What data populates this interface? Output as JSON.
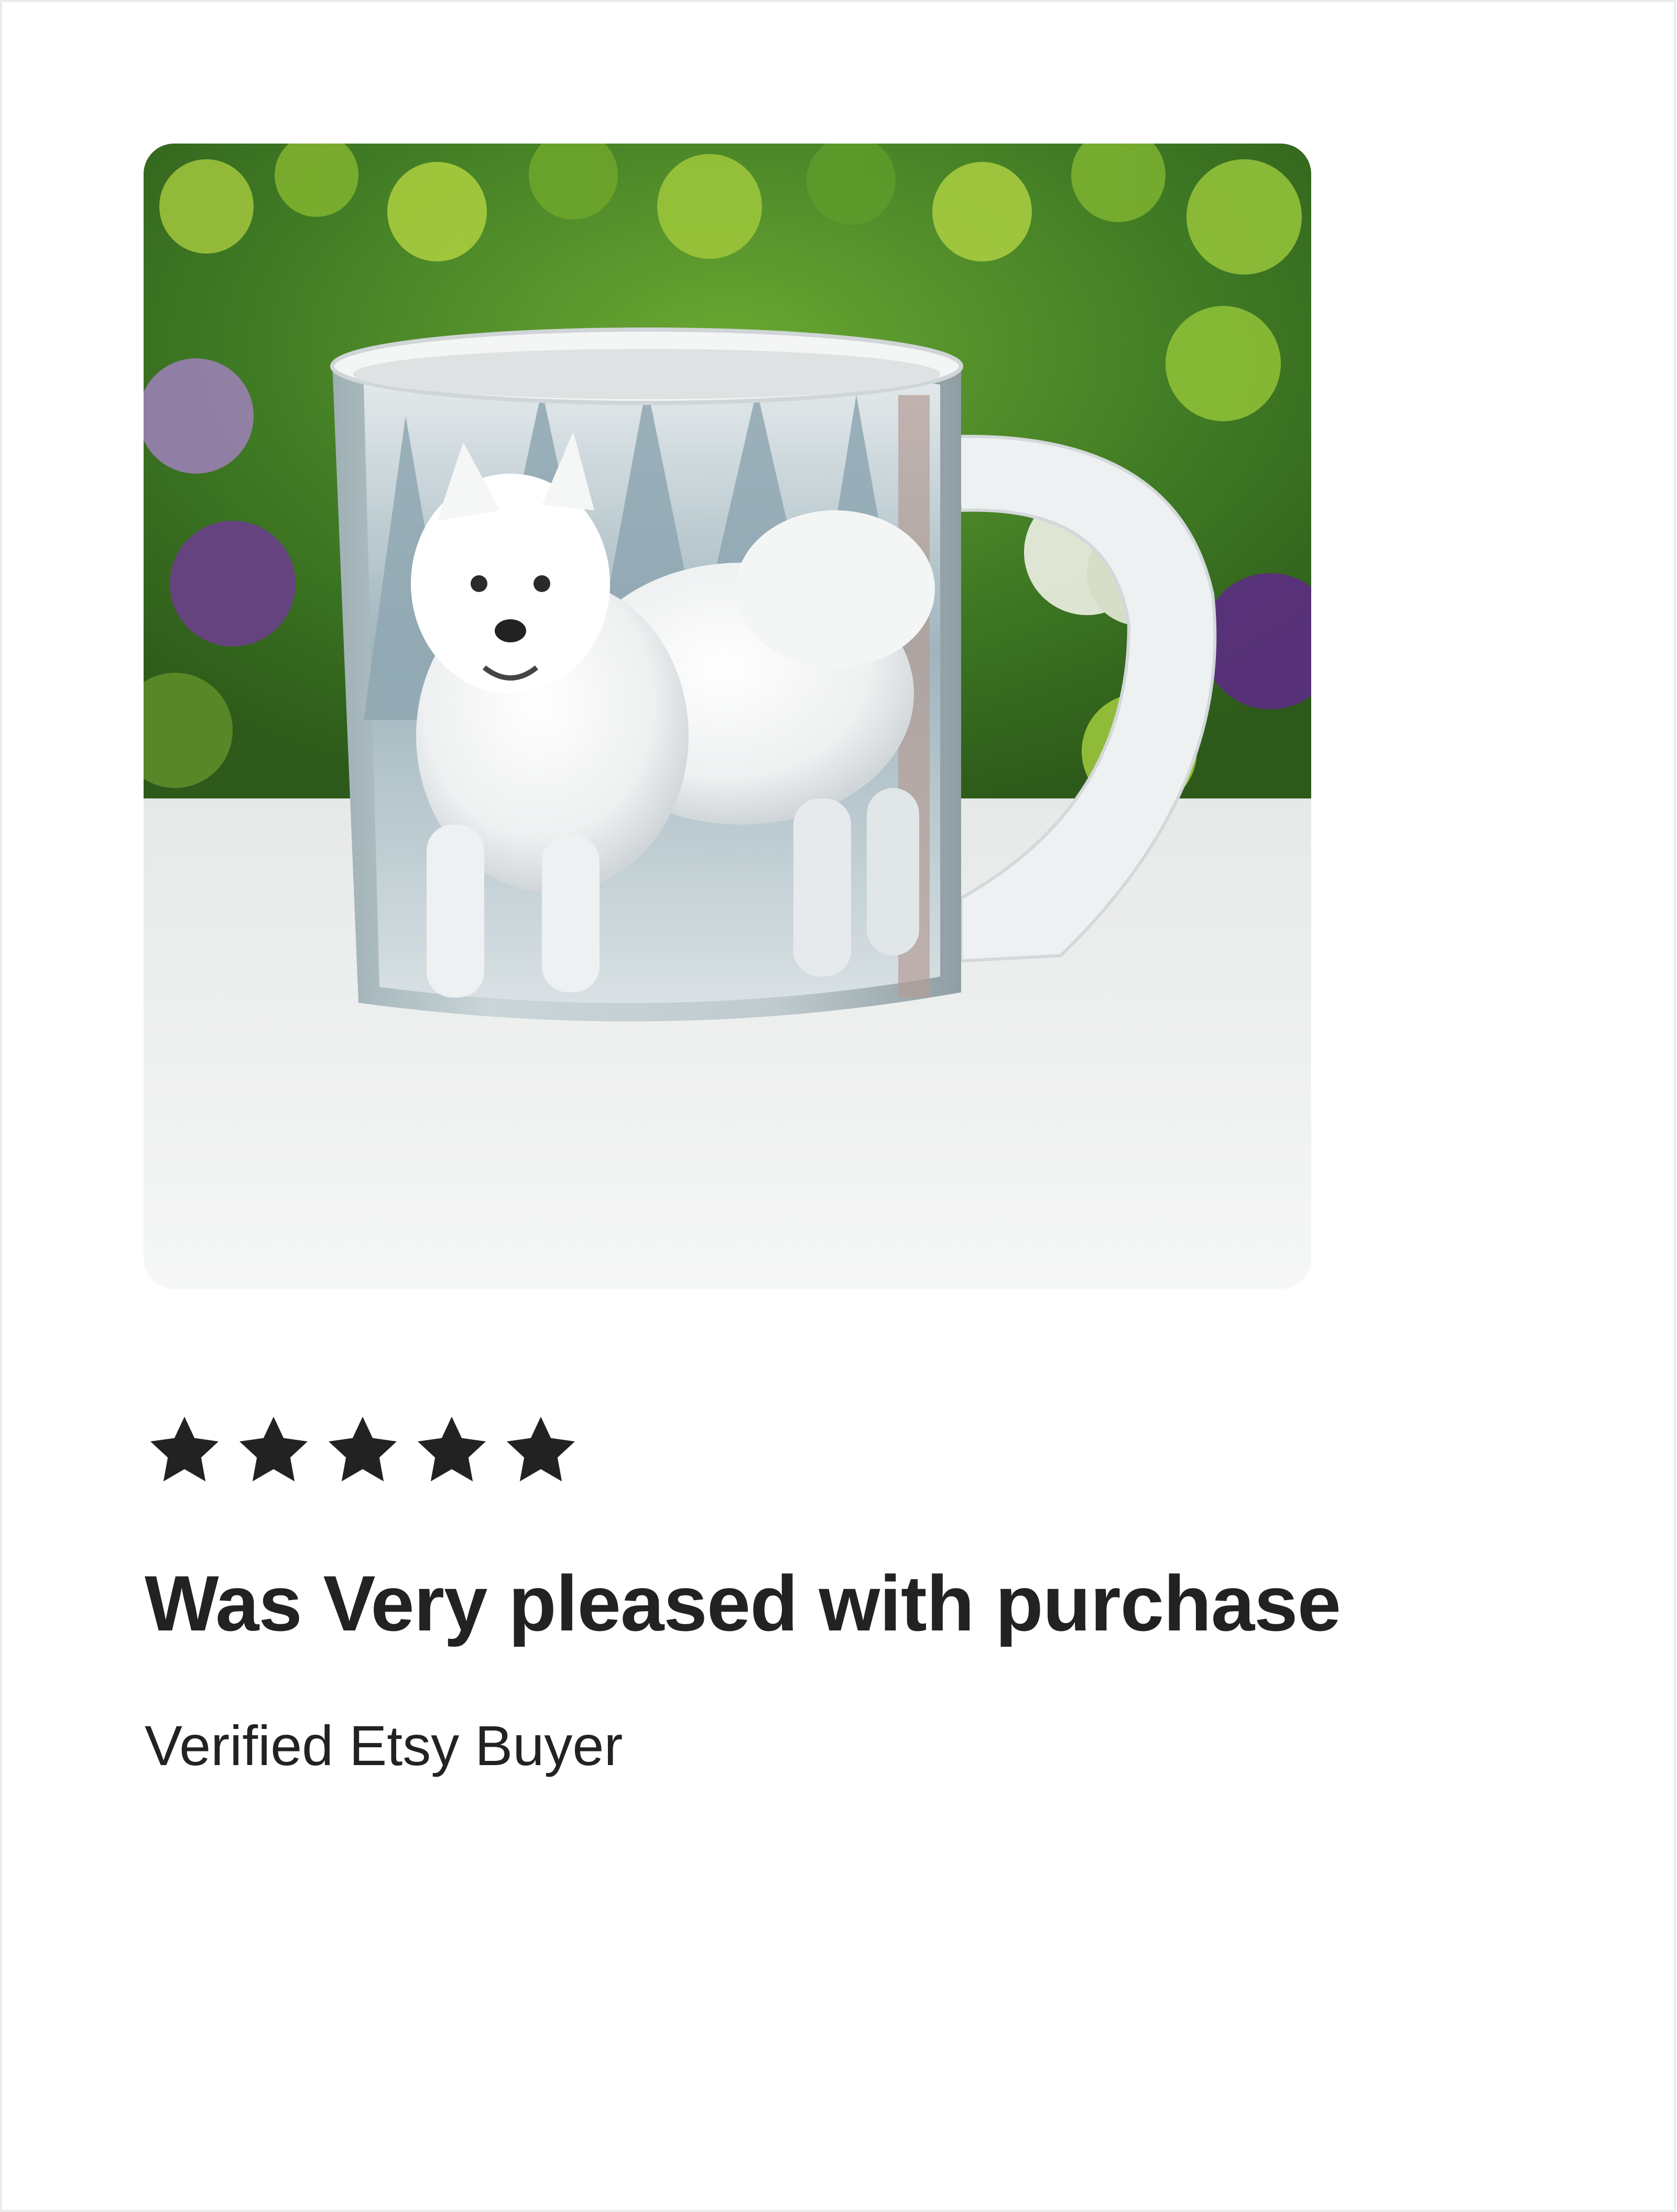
{
  "review": {
    "rating": 5,
    "rating_max": 5,
    "title": "Was Very pleased with purchase",
    "reviewer": "Verified Etsy Buyer",
    "star_color": "#222222"
  },
  "photo": {
    "subject": "mug-with-samoyed-dog-print",
    "background_colors": [
      "#5f9a2b",
      "#8e6aa3",
      "#eef0ee"
    ]
  }
}
